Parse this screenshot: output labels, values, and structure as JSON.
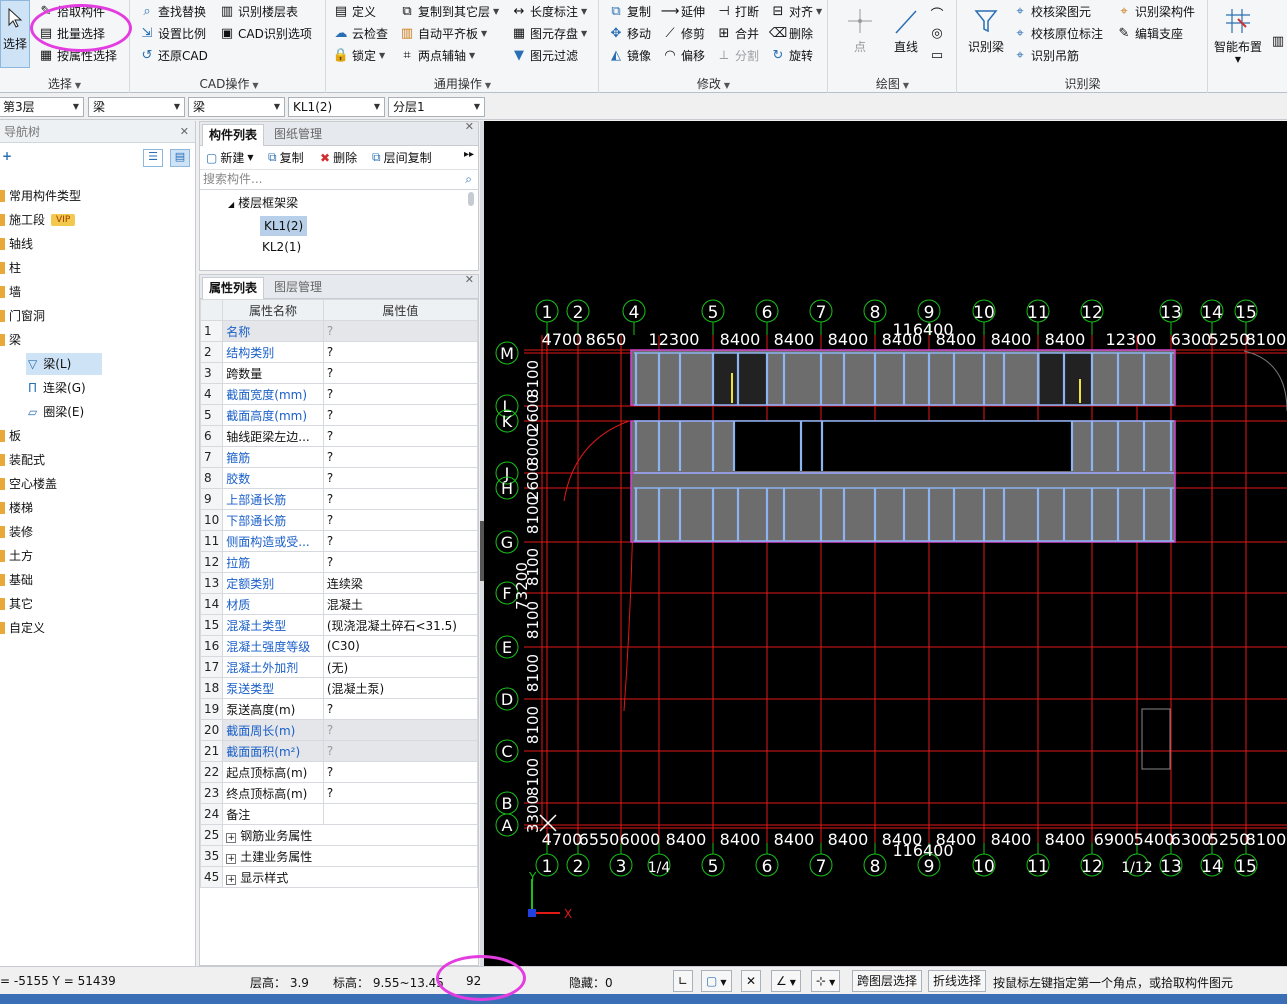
{
  "ribbon": {
    "select_group": {
      "big_label": "选择",
      "items": [
        "拾取构件",
        "批量选择",
        "按属性选择"
      ],
      "label": "选择"
    },
    "cad_group": {
      "items": [
        "查找替换",
        "识别楼层表",
        "设置比例",
        "CAD识别选项",
        "还原CAD"
      ],
      "label": "CAD操作"
    },
    "common_group": {
      "items": [
        "定义",
        "复制到其它层",
        "长度标注",
        "云检查",
        "自动平齐板",
        "图元存盘",
        "锁定",
        "两点辅轴",
        "图元过滤"
      ],
      "label": "通用操作"
    },
    "modify_group": {
      "items": [
        "复制",
        "延伸",
        "打断",
        "对齐",
        "移动",
        "修剪",
        "合并",
        "删除",
        "镜像",
        "偏移",
        "分割",
        "旋转"
      ],
      "label": "修改"
    },
    "draw_group": {
      "items": [
        "点",
        "直线"
      ],
      "label": "绘图"
    },
    "beam_recognize_group": {
      "big_label": "识别梁",
      "items": [
        "校核梁图元",
        "识别梁构件",
        "校核原位标注",
        "编辑支座",
        "识别吊筋"
      ],
      "label": "识别梁"
    },
    "smart_layout": "智能布置"
  },
  "selectors": [
    "第3层",
    "梁",
    "梁",
    "KL1(2)",
    "分层1"
  ],
  "navtree": {
    "title": "导航树",
    "items": [
      "常用构件类型",
      "施工段",
      "轴线",
      "柱",
      "墙",
      "门窗洞",
      "梁",
      "板",
      "装配式",
      "空心楼盖",
      "楼梯",
      "装修",
      "土方",
      "基础",
      "其它",
      "自定义"
    ],
    "vip": "VIP",
    "beam_children": [
      "梁(L)",
      "连梁(G)",
      "圈梁(E)"
    ]
  },
  "complist": {
    "tabs": [
      "构件列表",
      "图纸管理"
    ],
    "tools": [
      "新建",
      "复制",
      "删除",
      "层间复制"
    ],
    "search_placeholder": "搜索构件...",
    "group": "楼层框架梁",
    "items": [
      "KL1(2)",
      "KL2(1)"
    ]
  },
  "proplist": {
    "tabs": [
      "属性列表",
      "图层管理"
    ],
    "col_name": "属性名称",
    "col_value": "属性值",
    "rows": [
      {
        "n": "1",
        "name": "名称",
        "val": "?",
        "blue": true,
        "gray": true
      },
      {
        "n": "2",
        "name": "结构类别",
        "val": "?",
        "blue": true
      },
      {
        "n": "3",
        "name": "跨数量",
        "val": "?"
      },
      {
        "n": "4",
        "name": "截面宽度(mm)",
        "val": "?",
        "blue": true
      },
      {
        "n": "5",
        "name": "截面高度(mm)",
        "val": "?",
        "blue": true
      },
      {
        "n": "6",
        "name": "轴线距梁左边...",
        "val": "?"
      },
      {
        "n": "7",
        "name": "箍筋",
        "val": "?",
        "blue": true
      },
      {
        "n": "8",
        "name": "胶数",
        "val": "?",
        "blue": true
      },
      {
        "n": "9",
        "name": "上部通长筋",
        "val": "?",
        "blue": true
      },
      {
        "n": "10",
        "name": "下部通长筋",
        "val": "?",
        "blue": true
      },
      {
        "n": "11",
        "name": "侧面构造或受...",
        "val": "?",
        "blue": true
      },
      {
        "n": "12",
        "name": "拉筋",
        "val": "?",
        "blue": true
      },
      {
        "n": "13",
        "name": "定额类别",
        "val": "连续梁",
        "blue": true
      },
      {
        "n": "14",
        "name": "材质",
        "val": "混凝土",
        "blue": true
      },
      {
        "n": "15",
        "name": "混凝土类型",
        "val": "(现浇混凝土碎石<31.5)",
        "blue": true
      },
      {
        "n": "16",
        "name": "混凝土强度等级",
        "val": "(C30)",
        "blue": true
      },
      {
        "n": "17",
        "name": "混凝土外加剂",
        "val": "(无)",
        "blue": true
      },
      {
        "n": "18",
        "name": "泵送类型",
        "val": "(混凝土泵)",
        "blue": true
      },
      {
        "n": "19",
        "name": "泵送高度(m)",
        "val": "?"
      },
      {
        "n": "20",
        "name": "截面周长(m)",
        "val": "?",
        "blue": true,
        "gray": true
      },
      {
        "n": "21",
        "name": "截面面积(m²)",
        "val": "?",
        "blue": true,
        "gray": true
      },
      {
        "n": "22",
        "name": "起点顶标高(m)",
        "val": "?"
      },
      {
        "n": "23",
        "name": "终点顶标高(m)",
        "val": "?"
      },
      {
        "n": "24",
        "name": "备注",
        "val": ""
      }
    ],
    "expand_rows": [
      {
        "n": "25",
        "name": "钢筋业务属性"
      },
      {
        "n": "35",
        "name": "土建业务属性"
      },
      {
        "n": "45",
        "name": "显示样式"
      }
    ]
  },
  "canvas": {
    "top_axes": [
      "1",
      "2",
      "4",
      "5",
      "6",
      "7",
      "8",
      "9",
      "10",
      "11",
      "12",
      "13",
      "14",
      "15"
    ],
    "bottom_axes": [
      "1",
      "2",
      "3",
      "1/4",
      "5",
      "6",
      "7",
      "8",
      "9",
      "10",
      "11",
      "12",
      "1/12",
      "13",
      "14",
      "15"
    ],
    "left_axes": [
      "M",
      "L",
      "K",
      "J",
      "H",
      "G",
      "F",
      "E",
      "D",
      "C",
      "B",
      "A"
    ],
    "top_dims": [
      "4700",
      "8650",
      "12300",
      "8400",
      "8400",
      "8400",
      "8400",
      "8400",
      "8400",
      "8400",
      "12300",
      "6300",
      "5250",
      "8100"
    ],
    "bottom_dims": [
      "4700",
      "6550",
      "6000",
      "8400",
      "8400",
      "8400",
      "8400",
      "8400",
      "8400",
      "8400",
      "8400",
      "6900",
      "5400",
      "6300",
      "5250",
      "8100"
    ],
    "total_top": "116400",
    "total_bottom": "116400",
    "left_dims": [
      "8100",
      "2600",
      "8000",
      "2600",
      "8100",
      "8100",
      "8100",
      "8100",
      "8100",
      "8100",
      "3300"
    ],
    "left_total": "73200",
    "axis_x_label": "X",
    "axis_y_label": "Y"
  },
  "status": {
    "coords": "= -5155 Y = 51439",
    "floor_height": "层高： 3.9",
    "elevation": "标高： 9.55~13.45",
    "count": "92",
    "hidden": "隐藏：0",
    "btn_cross_layer": "跨图层选择",
    "btn_polyline": "折线选择",
    "hint": "按鼠标左键指定第一个角点，或拾取构件图元"
  }
}
